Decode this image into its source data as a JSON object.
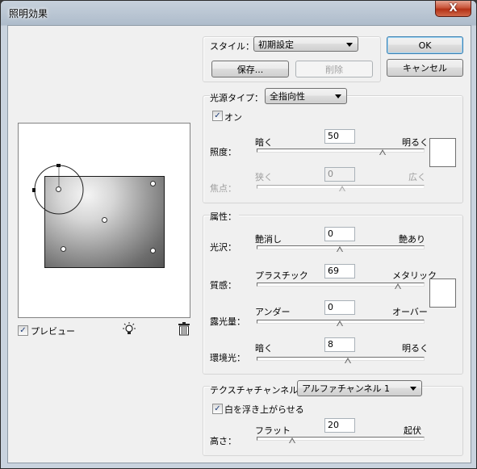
{
  "window": {
    "title": "照明効果",
    "close_symbol": "X"
  },
  "buttons": {
    "ok": "OK",
    "cancel": "キャンセル",
    "save": "保存...",
    "delete": "削除"
  },
  "style": {
    "label": "スタイル：",
    "value": "初期設定"
  },
  "light_type": {
    "label": "光源タイプ：",
    "value": "全指向性",
    "on_label": "オン",
    "on_checked": true,
    "intensity": {
      "label": "照度：",
      "low": "暗く",
      "high": "明るく",
      "value": "50",
      "level": 0.75
    },
    "focus": {
      "label": "焦点：",
      "low": "狭く",
      "high": "広く",
      "value": "0",
      "level": 0.5,
      "disabled": true
    },
    "color": "#ffffff"
  },
  "properties": {
    "label": "属性：",
    "gloss": {
      "label": "光沢：",
      "low": "艶消し",
      "high": "艶あり",
      "value": "0",
      "level": 0.5
    },
    "material": {
      "label": "質感：",
      "low": "プラスチック",
      "high": "メタリック",
      "value": "69",
      "level": 0.84
    },
    "exposure": {
      "label": "露光量：",
      "low": "アンダー",
      "high": "オーバー",
      "value": "0",
      "level": 0.5
    },
    "ambience": {
      "label": "環境光：",
      "low": "暗く",
      "high": "明るく",
      "value": "8",
      "level": 0.54
    },
    "color": "#ffffff"
  },
  "texture": {
    "label": "テクスチャチャンネル：",
    "channel": "アルファチャンネル 1",
    "white_high_label": "白を浮き上がらせる",
    "white_high_checked": true,
    "height": {
      "label": "高さ：",
      "low": "フラット",
      "high": "起伏",
      "value": "20",
      "level": 0.2
    }
  },
  "preview": {
    "label": "プレビュー",
    "checked": true,
    "check_mark": "✓"
  },
  "icons": {
    "lightbulb": "lightbulb-icon",
    "trash": "trash-icon"
  }
}
